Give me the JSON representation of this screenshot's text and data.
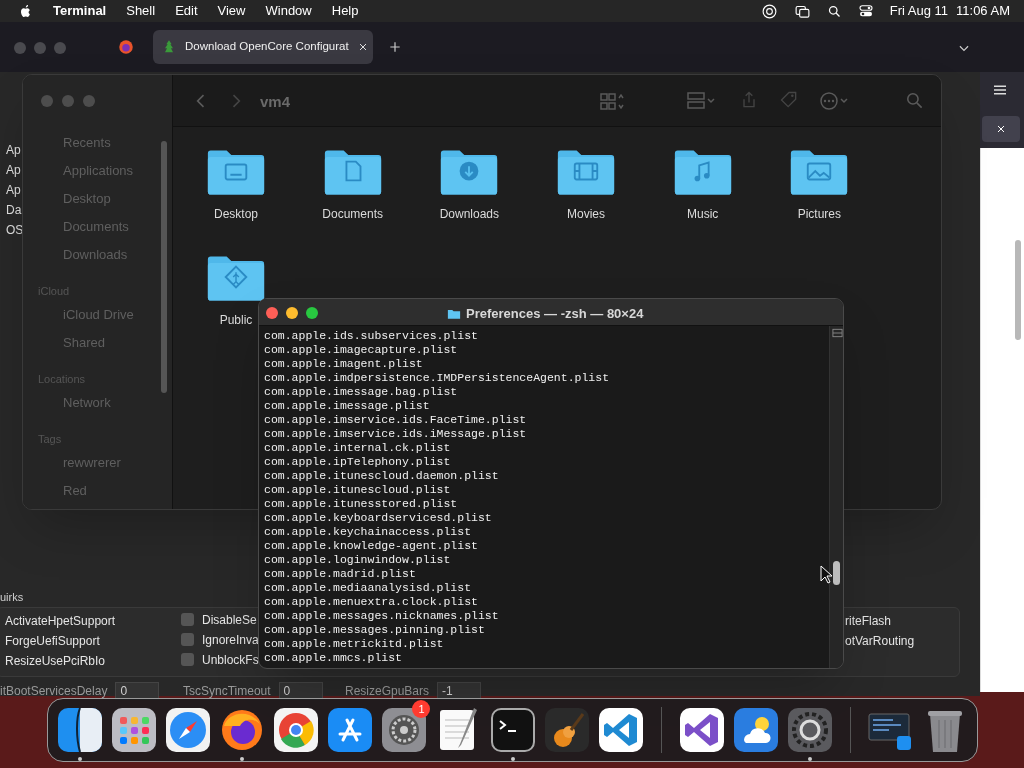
{
  "menubar": {
    "app": "Terminal",
    "menus": [
      "Shell",
      "Edit",
      "View",
      "Window",
      "Help"
    ],
    "date": "Fri Aug 11",
    "time": "11:06 AM"
  },
  "browser": {
    "tabs": [
      {
        "title": "Download OpenCore Configurat",
        "selected": true
      }
    ]
  },
  "background_app": {
    "sidebar_labels": [
      "Ap",
      "Ap",
      "Ap",
      "Da",
      "OS"
    ],
    "section": "uirks",
    "quirks_left": [
      "ActivateHpetSupport",
      "ForgeUefiSupport",
      "ResizeUsePciRbIo"
    ],
    "quirks_middle": [
      {
        "label": "DisableSe",
        "checked": false
      },
      {
        "label": "IgnoreInva",
        "checked": false
      },
      {
        "label": "UnblockFs",
        "checked": false
      }
    ],
    "quirks_right": [
      "riteFlash",
      "otVarRouting"
    ],
    "fields": [
      {
        "label": "itBootServicesDelay",
        "value": "0"
      },
      {
        "label": "TscSyncTimeout",
        "value": "0"
      },
      {
        "label": "ResizeGpuBars",
        "value": "-1"
      }
    ]
  },
  "finder": {
    "title": "vm4",
    "sidebar": [
      {
        "items": [
          "Recents",
          "Applications",
          "Desktop",
          "Documents",
          "Downloads"
        ]
      },
      {
        "heading": "iCloud",
        "items": [
          "iCloud Drive",
          "Shared"
        ]
      },
      {
        "heading": "Locations",
        "items": [
          "Network"
        ]
      },
      {
        "heading": "Tags",
        "items": [
          "rewwrerer",
          "Red"
        ]
      }
    ],
    "folders": [
      {
        "name": "Desktop",
        "kind": "desktop"
      },
      {
        "name": "Documents",
        "kind": "documents"
      },
      {
        "name": "Downloads",
        "kind": "downloads"
      },
      {
        "name": "Movies",
        "kind": "movies"
      },
      {
        "name": "Music",
        "kind": "music"
      },
      {
        "name": "Pictures",
        "kind": "pictures"
      },
      {
        "name": "Public",
        "kind": "public"
      }
    ]
  },
  "terminal": {
    "title": "Preferences — -zsh — 80×24",
    "lines": [
      "com.apple.ids.subservices.plist",
      "com.apple.imagecapture.plist",
      "com.apple.imagent.plist",
      "com.apple.imdpersistence.IMDPersistenceAgent.plist",
      "com.apple.imessage.bag.plist",
      "com.apple.imessage.plist",
      "com.apple.imservice.ids.FaceTime.plist",
      "com.apple.imservice.ids.iMessage.plist",
      "com.apple.internal.ck.plist",
      "com.apple.ipTelephony.plist",
      "com.apple.itunescloud.daemon.plist",
      "com.apple.itunescloud.plist",
      "com.apple.itunesstored.plist",
      "com.apple.keyboardservicesd.plist",
      "com.apple.keychainaccess.plist",
      "com.apple.knowledge-agent.plist",
      "com.apple.loginwindow.plist",
      "com.apple.madrid.plist",
      "com.apple.mediaanalysisd.plist",
      "com.apple.menuextra.clock.plist",
      "com.apple.messages.nicknames.plist",
      "com.apple.messages.pinning.plist",
      "com.apple.metrickitd.plist",
      "com.apple.mmcs.plist"
    ]
  },
  "dock": [
    {
      "kind": "finder",
      "running": true
    },
    {
      "kind": "launchpad",
      "running": false
    },
    {
      "kind": "safari",
      "running": false
    },
    {
      "kind": "firefox",
      "running": true
    },
    {
      "kind": "chrome",
      "running": false
    },
    {
      "kind": "appstore",
      "running": false
    },
    {
      "kind": "settings",
      "running": false,
      "badge": "1"
    },
    {
      "kind": "textedit",
      "running": false
    },
    {
      "kind": "terminal",
      "running": true
    },
    {
      "kind": "garageband",
      "running": false
    },
    {
      "kind": "vscode",
      "running": false
    },
    {
      "kind": "separator"
    },
    {
      "kind": "visualstudio",
      "running": false
    },
    {
      "kind": "weather",
      "running": false
    },
    {
      "kind": "gear",
      "running": true
    },
    {
      "kind": "separator"
    },
    {
      "kind": "stack",
      "running": false
    },
    {
      "kind": "trash",
      "running": false
    }
  ]
}
